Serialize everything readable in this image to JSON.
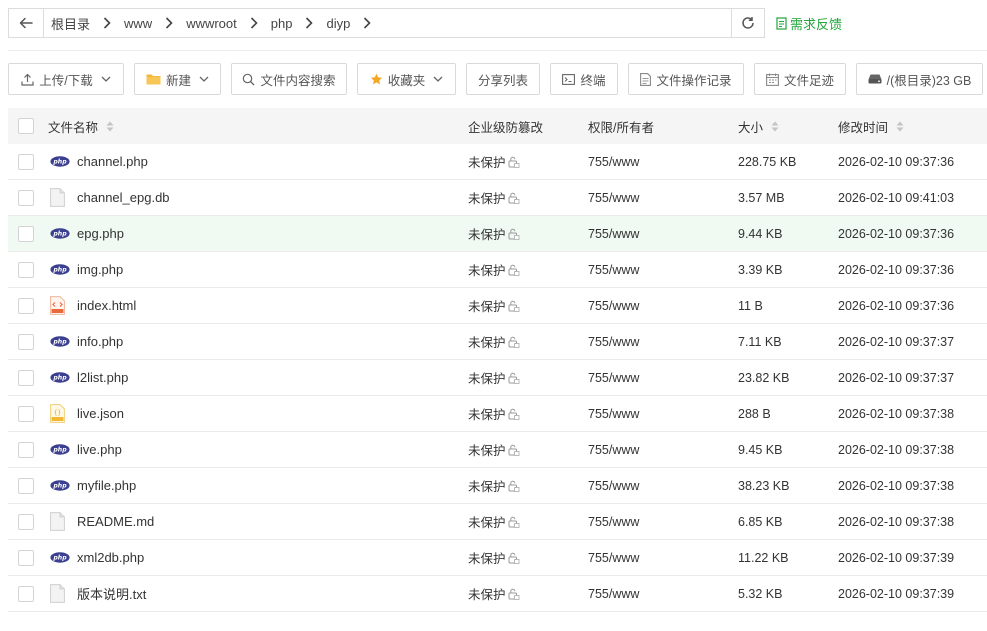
{
  "address": {
    "crumbs": [
      "根目录",
      "www",
      "wwwroot",
      "php",
      "diyp"
    ]
  },
  "feedback_label": "需求反馈",
  "toolbar": {
    "upload": "上传/下载",
    "new": "新建",
    "search_content": "文件内容搜索",
    "favorites": "收藏夹",
    "share_list": "分享列表",
    "terminal": "终端",
    "operation_log": "文件操作记录",
    "file_trail": "文件足迹",
    "disk": "/(根目录)23 GB"
  },
  "table": {
    "headers": {
      "name": "文件名称",
      "protection": "企业级防篡改",
      "permission": "权限/所有者",
      "size": "大小",
      "modified": "修改时间"
    },
    "rows": [
      {
        "name": "channel.php",
        "icon": "php-file-icon",
        "protection": "未保护",
        "permission": "755/www",
        "size": "228.75 KB",
        "modified": "2026-02-10 09:37:36"
      },
      {
        "name": "channel_epg.db",
        "icon": "generic-file-icon",
        "protection": "未保护",
        "permission": "755/www",
        "size": "3.57 MB",
        "modified": "2026-02-10 09:41:03"
      },
      {
        "name": "epg.php",
        "icon": "php-file-icon",
        "protection": "未保护",
        "permission": "755/www",
        "size": "9.44 KB",
        "modified": "2026-02-10 09:37:36"
      },
      {
        "name": "img.php",
        "icon": "php-file-icon",
        "protection": "未保护",
        "permission": "755/www",
        "size": "3.39 KB",
        "modified": "2026-02-10 09:37:36"
      },
      {
        "name": "index.html",
        "icon": "html-file-icon",
        "protection": "未保护",
        "permission": "755/www",
        "size": "11 B",
        "modified": "2026-02-10 09:37:36"
      },
      {
        "name": "info.php",
        "icon": "php-file-icon",
        "protection": "未保护",
        "permission": "755/www",
        "size": "7.11 KB",
        "modified": "2026-02-10 09:37:37"
      },
      {
        "name": "l2list.php",
        "icon": "php-file-icon",
        "protection": "未保护",
        "permission": "755/www",
        "size": "23.82 KB",
        "modified": "2026-02-10 09:37:37"
      },
      {
        "name": "live.json",
        "icon": "json-file-icon",
        "protection": "未保护",
        "permission": "755/www",
        "size": "288 B",
        "modified": "2026-02-10 09:37:38"
      },
      {
        "name": "live.php",
        "icon": "php-file-icon",
        "protection": "未保护",
        "permission": "755/www",
        "size": "9.45 KB",
        "modified": "2026-02-10 09:37:38"
      },
      {
        "name": "myfile.php",
        "icon": "php-file-icon",
        "protection": "未保护",
        "permission": "755/www",
        "size": "38.23 KB",
        "modified": "2026-02-10 09:37:38"
      },
      {
        "name": "README.md",
        "icon": "generic-file-icon",
        "protection": "未保护",
        "permission": "755/www",
        "size": "6.85 KB",
        "modified": "2026-02-10 09:37:38"
      },
      {
        "name": "xml2db.php",
        "icon": "php-file-icon",
        "protection": "未保护",
        "permission": "755/www",
        "size": "11.22 KB",
        "modified": "2026-02-10 09:37:39"
      },
      {
        "name": "版本说明.txt",
        "icon": "generic-file-icon",
        "protection": "未保护",
        "permission": "755/www",
        "size": "5.32 KB",
        "modified": "2026-02-10 09:37:39"
      }
    ]
  },
  "colors": {
    "accent_green": "#20a53a",
    "row_highlight": "#f0f9f2",
    "php_icon": "#3b3f8f",
    "favorites_star": "#f5a623",
    "folder": "#f5b73b"
  }
}
